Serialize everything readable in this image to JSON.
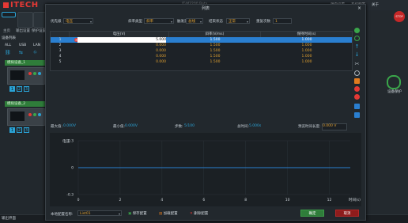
{
  "app": {
    "logo": "ITECH",
    "title": "IT-M3200 Beta",
    "menu": [
      "源自设置",
      "系统配置",
      "关于"
    ],
    "status": "输出界面"
  },
  "sidebar": {
    "tabs": [
      "主页",
      "输出设置",
      "保护设置"
    ],
    "section": "设备列表",
    "filters": [
      "ALL",
      "USB",
      "LAN"
    ],
    "devices": [
      {
        "name": "模拟设备_1",
        "channels": [
          "1",
          "2",
          "3"
        ]
      },
      {
        "name": "模拟设备_2",
        "channels": [
          "1",
          "2",
          "3"
        ]
      }
    ]
  },
  "rightpanel": {
    "stop": "STOP",
    "label": "设备保护"
  },
  "dialog": {
    "title": "列表",
    "close": "×",
    "mode_label": "优先级",
    "mode_value": "电压",
    "slope_label": "斜率类型",
    "slope_value": "斜率",
    "trigger_label": "触发源",
    "trigger_value": "总线",
    "end_label": "结束状态",
    "end_value": "正常",
    "repeat_label": "重复次数",
    "repeat_value": "1",
    "columns": [
      "电压(V)",
      "斜率(V/ms)",
      "保持时间(s)"
    ],
    "rows": [
      {
        "num": "1",
        "v": "5.000",
        "s": "1.500",
        "t": "1.000"
      },
      {
        "num": "2",
        "v": "0.000",
        "s": "1.500",
        "t": "1.000"
      },
      {
        "num": "3",
        "v": "0.000",
        "s": "1.500",
        "t": "1.000"
      },
      {
        "num": "4",
        "v": "0.000",
        "s": "1.500",
        "t": "1.000"
      },
      {
        "num": "5",
        "v": "0.000",
        "s": "1.500",
        "t": "1.000"
      }
    ],
    "stats": {
      "max_label": "最大值:",
      "max_value": "0.000V",
      "min_label": "最小值:",
      "min_value": "0.000V",
      "steps_label": "步数:",
      "steps_value": "5/100",
      "total_label": "总时间:",
      "total_value": "5.000s",
      "hold_label": "预览时间长度:",
      "hold_value": "0.000 V"
    },
    "config_label": "本地配置名称:",
    "config_value": "List01",
    "save_config": "保存配置",
    "load_config": "加载配置",
    "delete_config": "删除配置",
    "ok": "确定",
    "cancel": "取消"
  },
  "chart_data": {
    "type": "line",
    "ylabel": "电压",
    "xlabel": "时间(s)",
    "xlim": [
      0,
      13
    ],
    "ylim": [
      -0.3,
      0.3
    ],
    "xticks": [
      "0",
      "2",
      "4",
      "6",
      "8",
      "10",
      "12"
    ],
    "yticks": [
      "0.3",
      "0",
      "-0.3"
    ],
    "grid": true,
    "series": [
      {
        "values": [
          [
            0,
            0
          ],
          [
            13,
            0
          ]
        ],
        "color": "#2a7fd0"
      }
    ]
  }
}
